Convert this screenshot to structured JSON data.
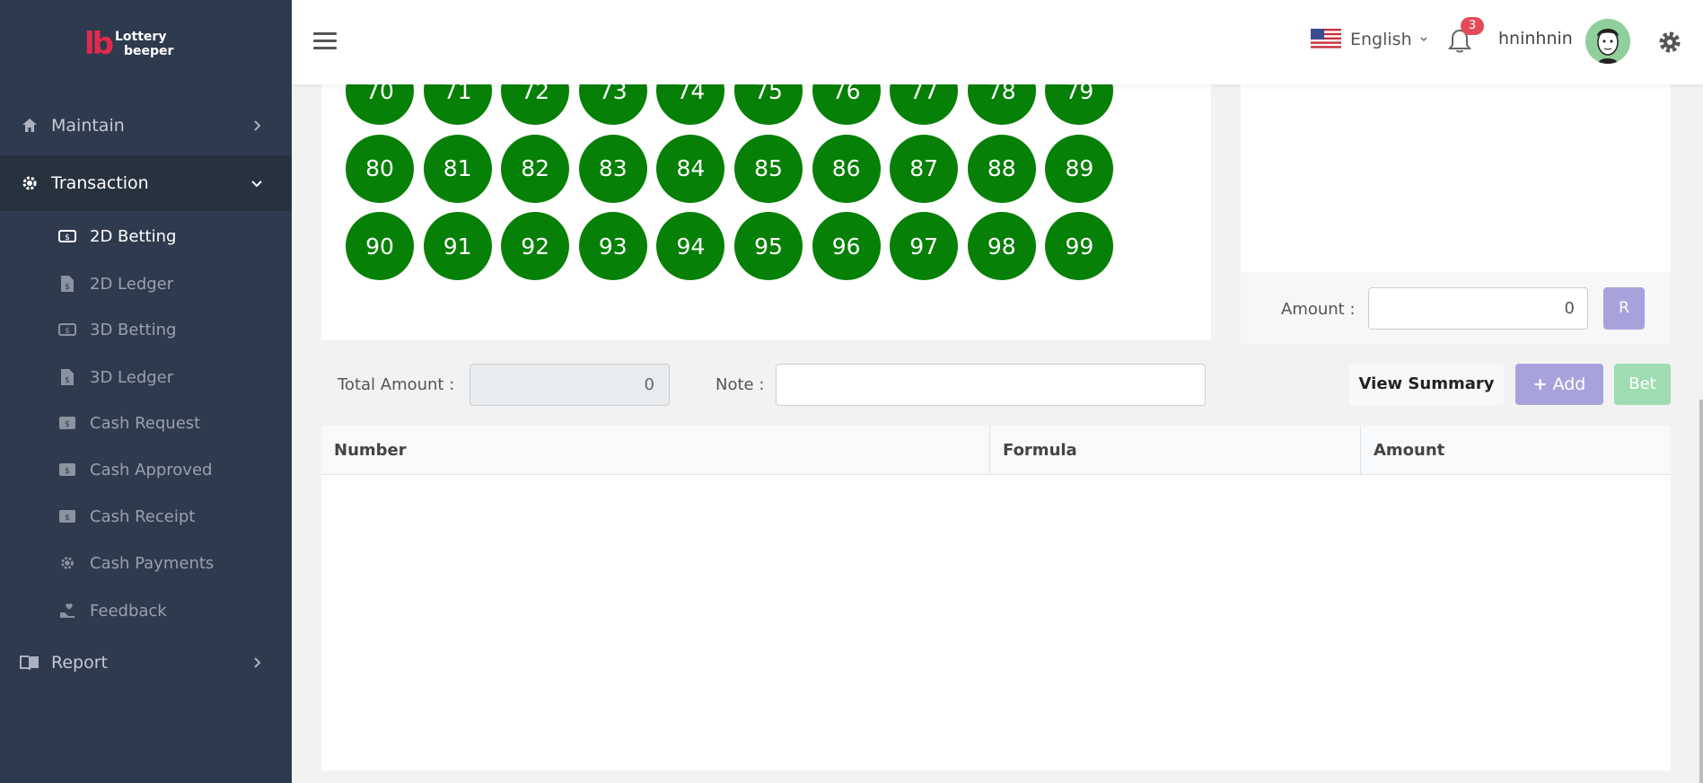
{
  "brand": {
    "mark": "lb",
    "line1": "Lottery",
    "line2": "beeper",
    "accent": "#e2294f"
  },
  "sidebar": {
    "items": [
      {
        "label": "Maintain",
        "icon": "home-icon"
      },
      {
        "label": "Transaction",
        "icon": "gear-icon"
      },
      {
        "label": "Report",
        "icon": "book-icon"
      }
    ],
    "sub_items": [
      {
        "label": "2D Betting",
        "icon": "cash-icon"
      },
      {
        "label": "2D Ledger",
        "icon": "file-dollar-icon"
      },
      {
        "label": "3D Betting",
        "icon": "cash-icon"
      },
      {
        "label": "3D Ledger",
        "icon": "file-dollar-icon"
      },
      {
        "label": "Cash Request",
        "icon": "cash-icon"
      },
      {
        "label": "Cash Approved",
        "icon": "cash-icon"
      },
      {
        "label": "Cash Receipt",
        "icon": "cash-icon"
      },
      {
        "label": "Cash Payments",
        "icon": "gear-icon"
      },
      {
        "label": "Feedback",
        "icon": "feedback-icon"
      }
    ]
  },
  "header": {
    "language": "English",
    "notification_count": "3",
    "username": "hninhnin"
  },
  "numbers": [
    "70",
    "71",
    "72",
    "73",
    "74",
    "75",
    "76",
    "77",
    "78",
    "79",
    "80",
    "81",
    "82",
    "83",
    "84",
    "85",
    "86",
    "87",
    "88",
    "89",
    "90",
    "91",
    "92",
    "93",
    "94",
    "95",
    "96",
    "97",
    "98",
    "99"
  ],
  "right_panel": {
    "amount_label": "Amount :",
    "amount_value": "0",
    "r_button": "R"
  },
  "form": {
    "total_label": "Total Amount :",
    "total_value": "0",
    "note_label": "Note :",
    "note_value": "",
    "view_summary": "View Summary",
    "add": "Add",
    "bet": "Bet"
  },
  "table": {
    "headers": [
      "Number",
      "Formula",
      "Amount"
    ],
    "rows": []
  },
  "colors": {
    "ball": "#078007",
    "sidebar": "#2e3b4e",
    "add_button": "#a8a2dc",
    "bet_button": "#9fdcb2",
    "badge": "#e54a5a"
  }
}
